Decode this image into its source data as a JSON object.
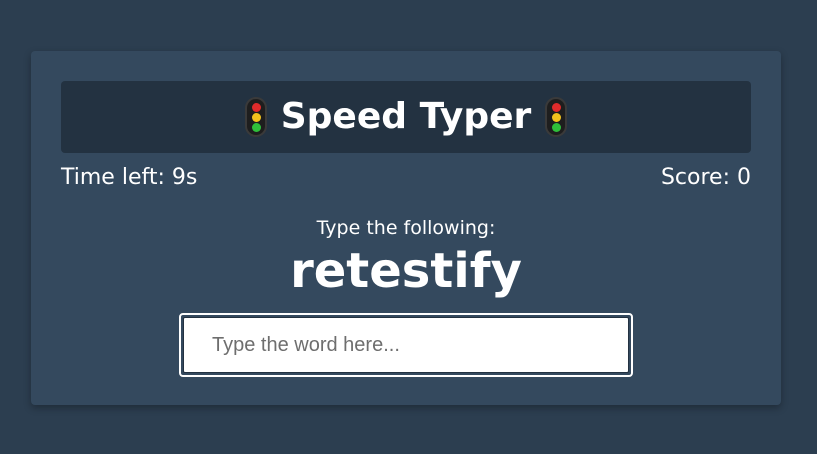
{
  "header": {
    "title": "Speed Typer",
    "left_icon": "traffic-light-icon",
    "right_icon": "traffic-light-icon"
  },
  "stats": {
    "time_left": "Time left: 9s",
    "score": "Score: 0"
  },
  "game": {
    "prompt": "Type the following:",
    "current_word": "retestify"
  },
  "input": {
    "placeholder": "Type the word here...",
    "value": ""
  },
  "colors": {
    "background": "#2c3e50",
    "card": "#34495e",
    "title_bar": "#233241",
    "text": "#ffffff"
  }
}
